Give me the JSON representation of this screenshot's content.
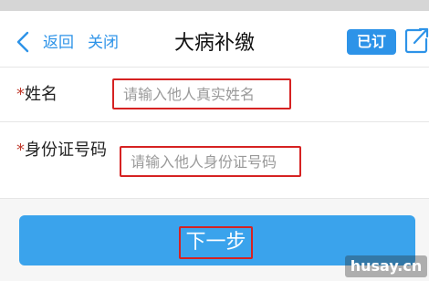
{
  "header": {
    "back_label": "返回",
    "close_label": "关闭",
    "title": "大病补缴",
    "badge_label": "已订",
    "back_icon": "chevron-left-icon",
    "share_icon": "share-icon"
  },
  "form": {
    "name": {
      "required_mark": "*",
      "label": "姓名",
      "placeholder": "请输入他人真实姓名",
      "value": ""
    },
    "id_number": {
      "required_mark": "*",
      "label": "身份证号码",
      "placeholder": "请输入他人身份证号码",
      "value": ""
    }
  },
  "actions": {
    "next_label": "下一步"
  },
  "watermark": {
    "text": "husay.cn"
  },
  "colors": {
    "accent": "#2d93e8",
    "button": "#3aa3ec",
    "highlight": "#d62222"
  }
}
